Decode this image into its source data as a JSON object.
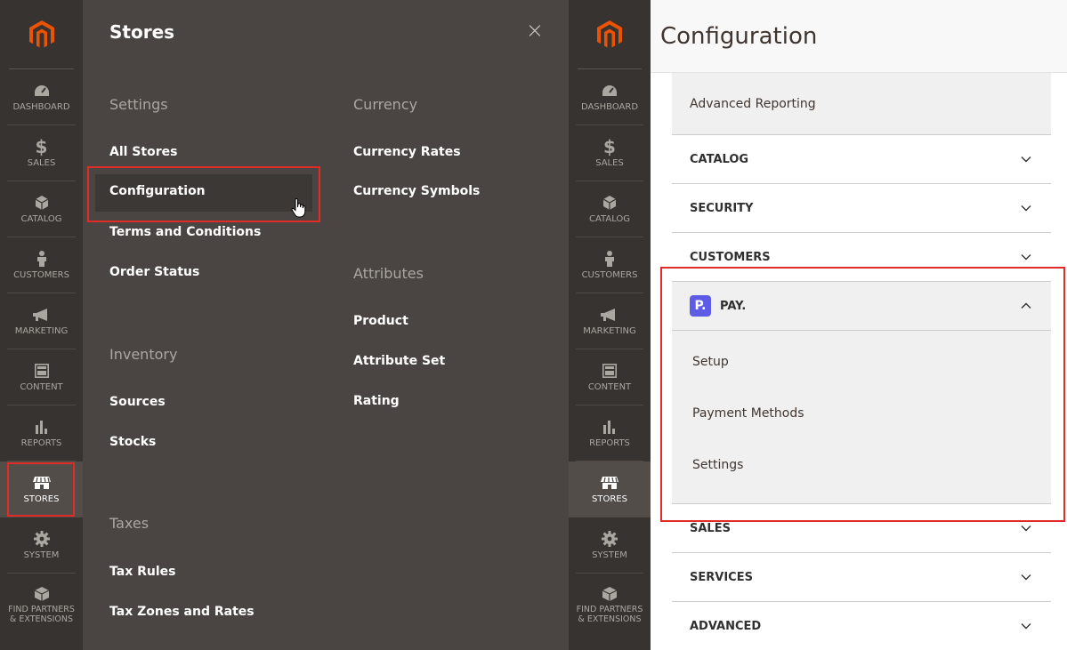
{
  "nav": {
    "items": [
      {
        "label": "DASHBOARD",
        "icon": "dashboard-icon"
      },
      {
        "label": "$",
        "sub": "SALES",
        "icon": "dollar-icon"
      },
      {
        "label": "CATALOG",
        "icon": "cube-icon"
      },
      {
        "label": "CUSTOMERS",
        "icon": "person-icon"
      },
      {
        "label": "MARKETING",
        "icon": "megaphone-icon"
      },
      {
        "label": "CONTENT",
        "icon": "layout-icon"
      },
      {
        "label": "REPORTS",
        "icon": "bar-chart-icon"
      },
      {
        "label": "STORES",
        "icon": "storefront-icon"
      },
      {
        "label": "SYSTEM",
        "icon": "gear-icon"
      },
      {
        "label1": "FIND PARTNERS",
        "label2": "& EXTENSIONS",
        "icon": "blocks-icon"
      }
    ],
    "active": "STORES"
  },
  "flyout": {
    "title": "Stores",
    "close": "×",
    "settings": {
      "title": "Settings",
      "links": [
        "All Stores",
        "Configuration",
        "Terms and Conditions",
        "Order Status"
      ]
    },
    "inventory": {
      "title": "Inventory",
      "links": [
        "Sources",
        "Stocks"
      ]
    },
    "taxes": {
      "title": "Taxes",
      "links": [
        "Tax Rules",
        "Tax Zones and Rates"
      ]
    },
    "currency": {
      "title": "Currency",
      "links": [
        "Currency Rates",
        "Currency Symbols"
      ]
    },
    "attributes": {
      "title": "Attributes",
      "links": [
        "Product",
        "Attribute Set",
        "Rating"
      ]
    }
  },
  "config": {
    "title": "Configuration",
    "advanced_reporting": "Advanced Reporting",
    "sections": [
      "CATALOG",
      "SECURITY",
      "CUSTOMERS"
    ],
    "pay": {
      "logo": "P.",
      "label": "PAY.",
      "subs": [
        "Setup",
        "Payment Methods",
        "Settings"
      ]
    },
    "sections_after": [
      "SALES",
      "SERVICES",
      "ADVANCED"
    ]
  },
  "colors": {
    "sidebar": "#373330",
    "flyout": "#4a4542",
    "highlight": "#e02b27",
    "pay_brand": "#5c5ce6"
  }
}
